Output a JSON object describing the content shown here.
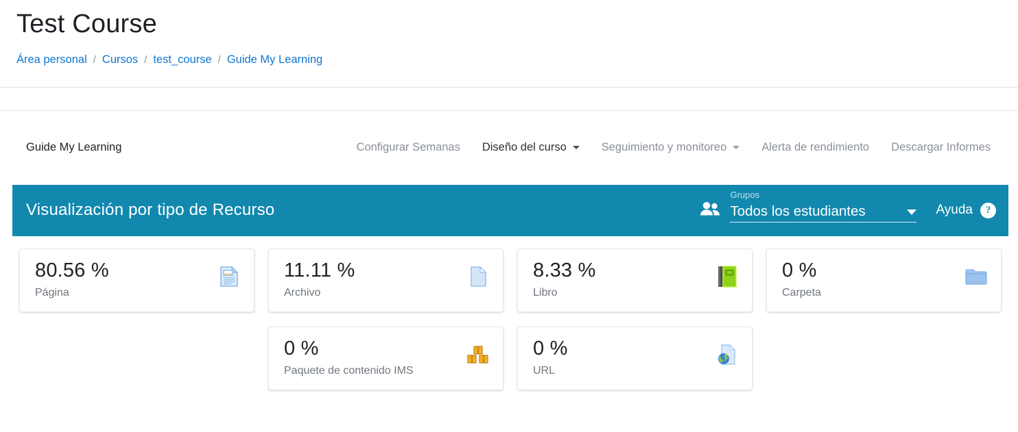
{
  "header": {
    "course_title": "Test Course",
    "breadcrumb": [
      {
        "label": "Área personal"
      },
      {
        "label": "Cursos"
      },
      {
        "label": "test_course"
      },
      {
        "label": "Guide My Learning"
      }
    ],
    "breadcrumb_separator": "/"
  },
  "nav": {
    "brand": "Guide My Learning",
    "items": [
      {
        "label": "Configurar Semanas",
        "has_caret": false,
        "active": false
      },
      {
        "label": "Diseño del curso",
        "has_caret": true,
        "active": true
      },
      {
        "label": "Seguimiento y monitoreo",
        "has_caret": true,
        "active": false
      },
      {
        "label": "Alerta de rendimiento",
        "has_caret": false,
        "active": false
      },
      {
        "label": "Descargar Informes",
        "has_caret": false,
        "active": false
      }
    ]
  },
  "band": {
    "title": "Visualización por tipo de Recurso",
    "groups_label": "Grupos",
    "groups_value": "Todos los estudiantes",
    "help_label": "Ayuda",
    "help_badge": "?",
    "accent_color": "#1288ae",
    "people_icon": "people-icon",
    "dropdown_icon": "chevron-down-icon",
    "help_icon": "question-mark-icon"
  },
  "chart_data": {
    "type": "bar",
    "title": "Visualización por tipo de Recurso",
    "categories": [
      "Página",
      "Archivo",
      "Libro",
      "Carpeta",
      "Paquete de contenido IMS",
      "URL"
    ],
    "values": [
      80.56,
      11.11,
      8.33,
      0,
      0,
      0
    ],
    "value_labels": [
      "80.56 %",
      "11.11 %",
      "8.33 %",
      "0 %",
      "0 %",
      "0 %"
    ],
    "unit": "%",
    "xlabel": "",
    "ylabel": "",
    "ylim": [
      0,
      100
    ],
    "legend": []
  },
  "cards": {
    "row1": [
      {
        "value": "80.56 %",
        "label": "Página",
        "icon": "page-document-icon"
      },
      {
        "value": "11.11 %",
        "label": "Archivo",
        "icon": "file-icon"
      },
      {
        "value": "8.33 %",
        "label": "Libro",
        "icon": "book-icon"
      },
      {
        "value": "0 %",
        "label": "Carpeta",
        "icon": "folder-icon"
      }
    ],
    "row2": [
      {
        "value": "0 %",
        "label": "Paquete de contenido IMS",
        "icon": "ims-package-icon"
      },
      {
        "value": "0 %",
        "label": "URL",
        "icon": "url-globe-icon"
      }
    ]
  }
}
